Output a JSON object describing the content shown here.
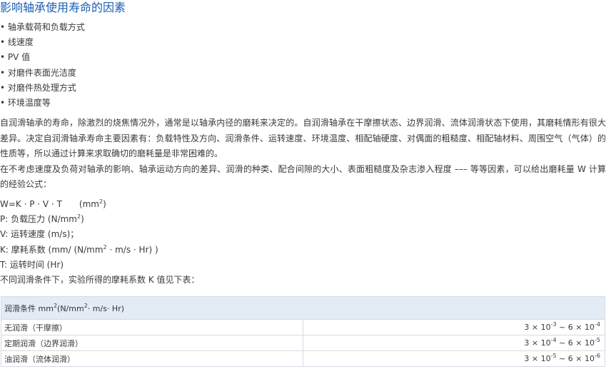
{
  "title": "影响轴承使用寿命的因素",
  "bullets": [
    "• 轴承载荷和负载方式",
    "• 线速度",
    "• PV 值",
    "• 对磨件表面光洁度",
    "• 对磨件热处理方式",
    "• 环境温度等"
  ],
  "paragraph1": "自润滑轴承的寿命，除激烈的烧焦情况外，通常是以轴承内径的磨耗来决定的。自润滑轴承在干摩擦状态、边界润滑、流体润滑状态下使用，其磨耗情形有很大差异。决定自润滑轴承寿命主要因素有：负载特性及方向、润滑条件、运转速度、环境温度、相配轴硬度、对偶面的粗糙度、相配轴材料、周围空气（气体）的性质等，所以通过计算来求取确切的磨耗量是非常困难的。",
  "paragraph2": "在不考虑速度及负荷对轴承的影响、轴承运动方向的差异、润滑的种类、配合间隙的大小、表面粗糙度及杂志渗入程度 ––– 等等因素，可以给出磨耗量 W 计算的经验公式：",
  "formula": {
    "w_line": "W=K · P · V · T",
    "w_unit": "(mm",
    "w_unit_exp": "2",
    "w_unit_close": ")",
    "p_line": "P: 负载压力 (N/mm",
    "p_exp": "2",
    "p_close": ")",
    "v_line": "V: 运转速度 (m/s)；",
    "k_line": "K: 摩耗系数 (mm/ (N/mm",
    "k_exp": "2",
    "k_close": " · m/s · Hr) )",
    "t_line": "T: 运转时间 (Hr)",
    "note": "不同润滑条件下，实验所得的摩耗系数 K 值见下表："
  },
  "table": {
    "header_pre": "润滑条件 mm",
    "header_exp": "2",
    "header_mid": "(N/mm",
    "header_exp2": "2",
    "header_post": "· m/s· Hr)",
    "rows": [
      {
        "label": "无润滑（干摩擦）",
        "a": "3 × 10",
        "a_exp": "-3",
        "sep": " ~ 6 × 10",
        "b_exp": "-4"
      },
      {
        "label": "定期润滑（边界润滑）",
        "a": "3 × 10",
        "a_exp": "-4",
        "sep": " ~ 6 × 10",
        "b_exp": "-5"
      },
      {
        "label": "油润滑（流体润滑）",
        "a": "3 × 10",
        "a_exp": "-5",
        "sep": " ~ 6 × 10",
        "b_exp": "-6"
      }
    ]
  }
}
